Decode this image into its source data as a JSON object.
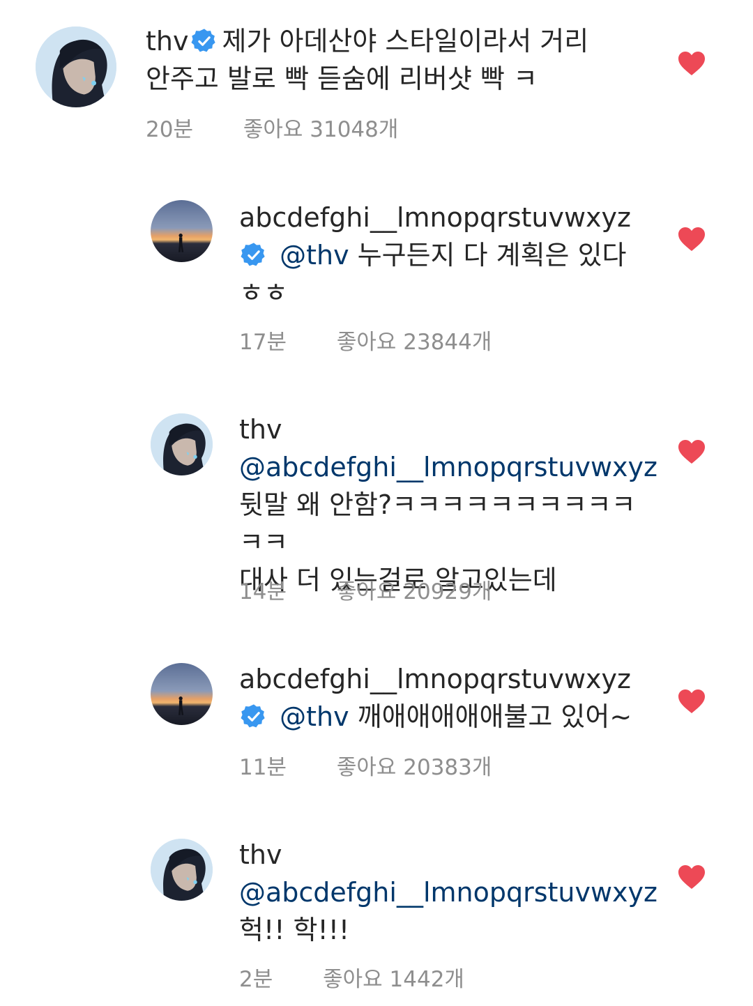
{
  "comments": [
    {
      "username": "thv",
      "verified": true,
      "text_lines": [
        "제가 아데산야 스타일이라서 거리",
        "안주고 발로 빡 듣숨에 리버샷 빡 ㅋ"
      ],
      "time": "20분",
      "likes": "좋아요 31048개"
    },
    {
      "username": "abcdefghi__lmnopqrstuvwxyz",
      "verified": true,
      "mention": "@thv",
      "text": "누구든지 다 계획은 있다",
      "text_line2": "ㅎㅎ",
      "time": "17분",
      "likes": "좋아요 23844개"
    },
    {
      "username": "thv",
      "mention": "@abcdefghi__lmnopqrstuvwxyz",
      "text_lines": [
        "뒷말 왜 안함?ㅋㅋㅋㅋㅋㅋㅋㅋㅋㅋㅋㅋ",
        "대사 더 있는걸로 알고있는데"
      ],
      "time": "14분",
      "likes": "좋아요 20929개"
    },
    {
      "username": "abcdefghi__lmnopqrstuvwxyz",
      "verified": true,
      "mention": "@thv",
      "text": "깨애애애애애불고 있어~",
      "time": "11분",
      "likes": "좋아요 20383개"
    },
    {
      "username": "thv",
      "mention": "@abcdefghi__lmnopqrstuvwxyz",
      "text": "헉!! 학!!!",
      "time": "2분",
      "likes": "좋아요 1442개"
    }
  ],
  "colors": {
    "verified": "#3897f0",
    "mention": "#00376b",
    "heart": "#ed4956",
    "meta": "#8e8e8e"
  },
  "icons": [
    "verified-badge-icon",
    "heart-icon"
  ]
}
